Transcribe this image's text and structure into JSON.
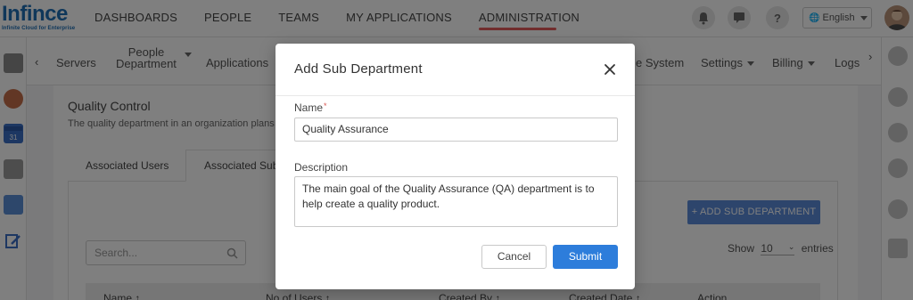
{
  "brand": {
    "logo_text": "Infince",
    "tagline": "Infinite Cloud for Enterprise",
    "primary_color": "#1f6fb5",
    "active_underline_color": "#e35a5a"
  },
  "top_nav": {
    "items": [
      {
        "label": "DASHBOARDS"
      },
      {
        "label": "PEOPLE"
      },
      {
        "label": "TEAMS"
      },
      {
        "label": "MY APPLICATIONS"
      },
      {
        "label": "ADMINISTRATION",
        "active": true
      }
    ],
    "language": "English",
    "icons": [
      "bell-icon",
      "chat-notification-icon",
      "help-icon",
      "globe-icon"
    ]
  },
  "sub_nav": {
    "items": [
      {
        "label": "Servers"
      },
      {
        "label": "People\nDepartment",
        "line1": "People",
        "line2": "Department",
        "has_dropdown": true
      },
      {
        "label": "Applications"
      },
      {
        "label": "e System"
      },
      {
        "label": "Settings",
        "has_dropdown": true
      },
      {
        "label": "Billing",
        "has_dropdown": true
      },
      {
        "label": "Logs"
      }
    ]
  },
  "page": {
    "title": "Quality Control",
    "description": "The quality department in an organization plans",
    "tabs": [
      {
        "label": "Associated Users"
      },
      {
        "label": "Associated Sub",
        "active": true
      }
    ],
    "add_button_label": "+ ADD SUB DEPARTMENT",
    "search_placeholder": "Search...",
    "show_label": "Show",
    "show_value": "10",
    "entries_label": "entries",
    "table_headers": [
      "Name ↑",
      "No of Users ↕",
      "Created By ↕",
      "Created Date ↕",
      "Action"
    ]
  },
  "modal": {
    "title": "Add Sub Department",
    "name_label": "Name",
    "name_required_mark": "*",
    "name_value": "Quality Assurance",
    "description_label": "Description",
    "description_value": "The main goal of the Quality Assurance (QA) department is to help create a quality product.",
    "cancel_label": "Cancel",
    "submit_label": "Submit",
    "submit_color": "#2d7ddb"
  }
}
